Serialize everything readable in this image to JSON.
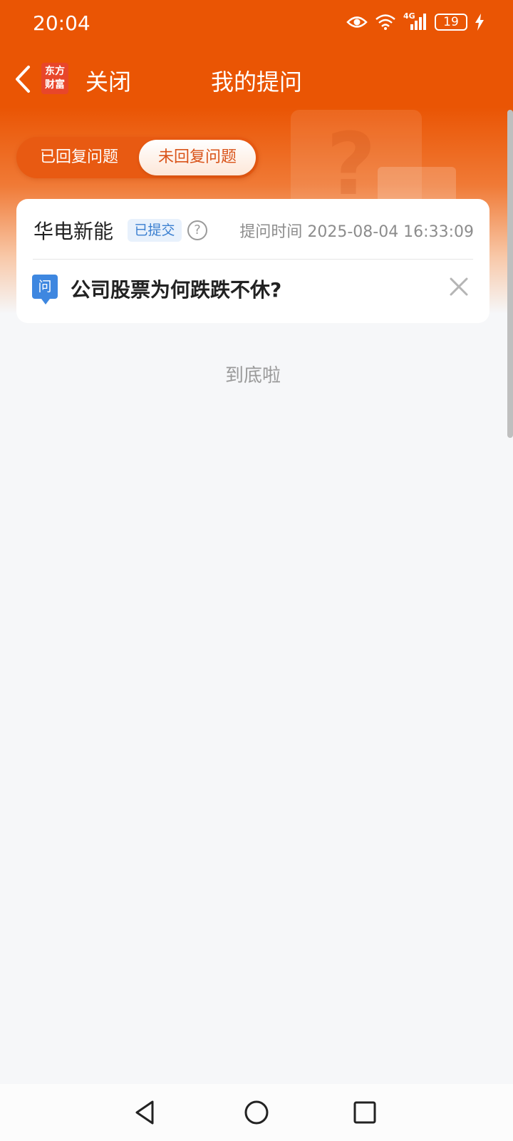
{
  "status_bar": {
    "time": "20:04",
    "network": "4G",
    "battery": "19",
    "icons": [
      "eye-icon",
      "wifi-icon",
      "signal-icon",
      "battery-icon",
      "charging-icon"
    ]
  },
  "nav": {
    "app_logo_text": "东方财富",
    "close_label": "关闭",
    "title": "我的提问"
  },
  "tabs": {
    "answered": "已回复问题",
    "unanswered": "未回复问题",
    "selected": "unanswered"
  },
  "question_card": {
    "company": "华电新能",
    "status_badge": "已提交",
    "ask_time_label": "提问时间 2025-08-04 16:33:09",
    "question_icon_text": "问",
    "question": "公司股票为何跌跌不休?"
  },
  "list_end": "到底啦",
  "colors": {
    "primary": "#ea5504",
    "badge_blue": "#3a7fd0",
    "question_icon": "#3e87e0",
    "page_bg": "#f6f7f9"
  }
}
